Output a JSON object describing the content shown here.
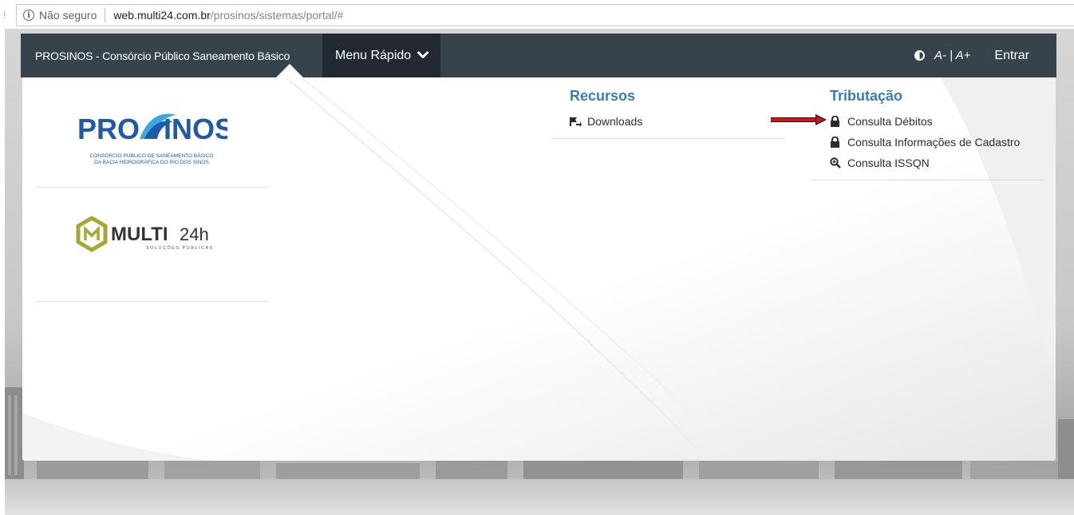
{
  "browser": {
    "security_label": "Não seguro",
    "url_host": "web.multi24.com.br",
    "url_path": "/prosinos/sistemas/portal/#"
  },
  "navbar": {
    "brand": "PROSINOS - Consórcio Público Saneamento Básico",
    "quick_menu": "Menu Rápido",
    "font_decrease": "A-",
    "font_sep": "|",
    "font_increase": "A+",
    "login": "Entrar"
  },
  "logos": {
    "prosinos_left": "PRO",
    "prosinos_right": "INOS",
    "prosinos_line1": "CONSÓRCIO PÚBLICO DE SANEAMENTO BÁSICO",
    "prosinos_line2": "DA BACIA HIDROGRÁFICA DO RIO DOS SINOS",
    "multi_name": "MULTI",
    "multi_suffix": "24h",
    "multi_tagline": "SOLUÇÕES PÚBLICAS"
  },
  "recursos": {
    "title": "Recursos",
    "items": [
      {
        "label": "Downloads",
        "icon": "downloads-icon"
      }
    ]
  },
  "tributacao": {
    "title": "Tributação",
    "items": [
      {
        "label": "Consulta Débitos",
        "icon": "lock-icon"
      },
      {
        "label": "Consulta Informações de Cadastro",
        "icon": "lock-icon"
      },
      {
        "label": "Consulta ISSQN",
        "icon": "search-plus-icon"
      }
    ]
  },
  "colors": {
    "navbar": "#37434a",
    "quick_menu": "#212a30",
    "section_title": "#3a7cb8",
    "annotation_arrow": "#d0151d",
    "prosinos_blue": "#1f5aa6",
    "multi_green": "#a9a635"
  }
}
